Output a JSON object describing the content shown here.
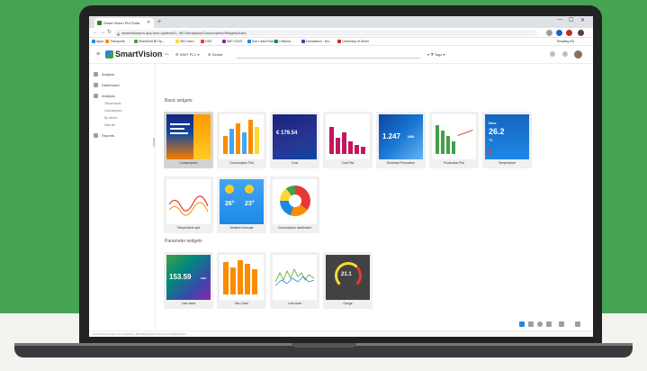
{
  "browser": {
    "tab_title": "Smart Vision Pro Solar",
    "url": "smartvisionpro.app.hsm.systems/1_9874/Analysis/Consumption/Widgets/Area",
    "bookmarks": [
      "Apps",
      "Transports",
      "WorldSoft BI Op...",
      "SM Learn",
      "HSS",
      "WIFI ODIS",
      "Solr Lead Rules",
      "Chilpina",
      "Nomadeon - Mo...",
      "University of Dimer"
    ],
    "reading_list": "Reading list"
  },
  "app": {
    "logo_text": "SmartVision",
    "logo_sup": "Pro",
    "site_selector": "WWT PLC",
    "area_selector": "Global",
    "tags_label": "Tags"
  },
  "sidebar": {
    "items": [
      {
        "label": "Analyse",
        "icon": "analyse-icon"
      },
      {
        "label": "Dashboard",
        "icon": "dashboard-icon"
      },
      {
        "label": "Analysis",
        "icon": "analysis-icon"
      }
    ],
    "sub_items": [
      "Temperature",
      "Consumption",
      "By device",
      "Data list"
    ],
    "reports": {
      "label": "Reports",
      "icon": "reports-icon"
    }
  },
  "sections": {
    "basic_title": "Basic widgets",
    "parameter_title": "Parameter widgets"
  },
  "basic_widgets": [
    {
      "label": "Consumption",
      "selected": true
    },
    {
      "label": "Consumption Plot"
    },
    {
      "label": "Cost"
    },
    {
      "label": "Cost Plot"
    },
    {
      "label": "Electrical Production"
    },
    {
      "label": "Production Plot"
    },
    {
      "label": "Temperature"
    },
    {
      "label": "Temperature plot"
    },
    {
      "label": "Weather forecast"
    },
    {
      "label": "Consumption distribution"
    }
  ],
  "parameter_widgets": [
    {
      "label": "Last value"
    },
    {
      "label": "Bar Chart"
    },
    {
      "label": "Line chart"
    },
    {
      "label": "Gauge"
    }
  ],
  "thumb_text": {
    "cost_value": "€ 179.54",
    "production_value": "1.247",
    "production_unit": "kWh",
    "temperature_label": "Now",
    "temperature_value": "26.2",
    "temperature_unit": "°C",
    "weather_left": "26°",
    "weather_right": "23°",
    "last_value": "153.59",
    "last_value_unit": "kWh",
    "gauge_value": "21.1"
  },
  "colors": {
    "background_green": "#45a452",
    "brand_blue": "#1e88e5",
    "brand_green": "#43a047",
    "selected_card": "#d3d3d3"
  }
}
